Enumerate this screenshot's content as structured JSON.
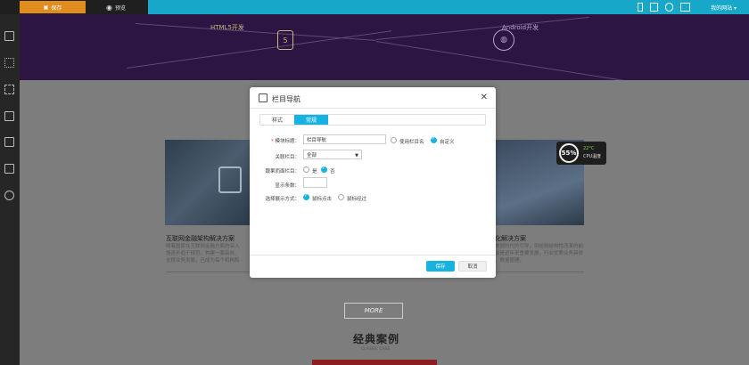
{
  "topbar": {
    "save_label": "保存",
    "preview_label": "预览",
    "site_link": "我的网站 ▾",
    "icons": [
      "mobile-icon",
      "tablet-icon",
      "chat-icon",
      "monitor-icon"
    ]
  },
  "sidebar": {
    "icons": [
      "layout-icon",
      "sitemap-icon",
      "select-icon",
      "crop-icon",
      "layers-icon",
      "copy-icon",
      "gear-icon"
    ]
  },
  "banner": {
    "left_label": "HTML5开发",
    "right_label": "Android开发",
    "html5_glyph": "5",
    "android_glyph": "◍"
  },
  "cards": {
    "left_title": "互联网金融架构解决方案",
    "left_text": [
      "随着国家在互联网金融方面的深入",
      "场逐步趋于规范。构建一套高效、",
      "支撑业务发展，已成为每个机构和"
    ],
    "right_title": "化解决方案",
    "right_text": [
      "数据时代的引导，供给侧结构性改革的前",
      "级是近年来重要发展，行业优质业务具体",
      "，数据整理。"
    ]
  },
  "cpu": {
    "percent": "55%",
    "temp": "22°C",
    "label": "CPU温度"
  },
  "more_label": "MORE",
  "cases": {
    "title": "经典案例",
    "subtitle": "CLASSIC CASE"
  },
  "dialog": {
    "title": "栏目导航",
    "close": "✕",
    "tabs": [
      {
        "label": "样式"
      },
      {
        "label": "常规"
      }
    ],
    "module_title_label": "模块标题：",
    "module_title_required": "*",
    "module_title_value": "栏目导航",
    "use_column_name": "使用栏目名",
    "custom": "自定义",
    "related_column_label": "关联栏目：",
    "related_column_value": "全部",
    "follow_page_label": "跟果而面栏目：",
    "opt_yes": "是",
    "opt_no": "否",
    "display_count_label": "显示条数：",
    "display_count_value": "",
    "expand_mode_label": "选择展示方式：",
    "expand_click": "鼠标点击",
    "expand_hover": "鼠标经过",
    "save_button": "保存",
    "cancel_button": "取消"
  },
  "colors": {
    "accent": "#17b2e0",
    "topbar": "#17a7c9",
    "save_tab": "#e08c1e",
    "banner": "#2c1542"
  }
}
